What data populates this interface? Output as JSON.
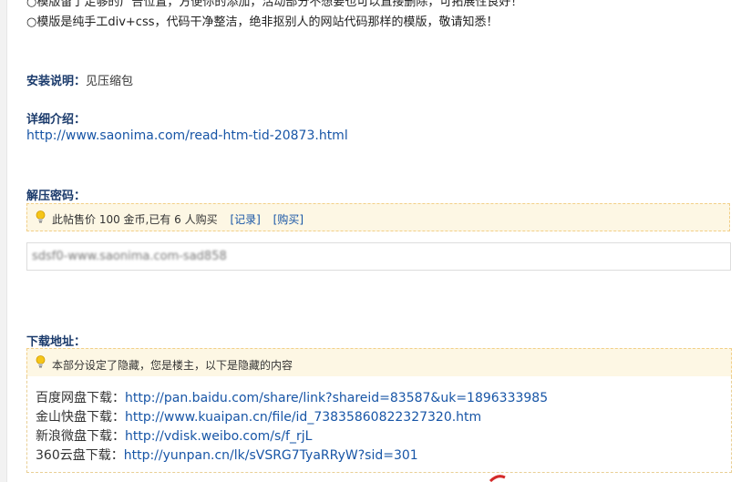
{
  "intro": {
    "line1": "○模版留了足够的广告位置，方便你的添加，活动部分不想要也可以直接删除，可拓展性良好！",
    "line2": "○模版是纯手工div+css，代码干净整洁，绝非抠别人的网站代码那样的模版，敬请知悉！"
  },
  "install": {
    "label": "安装说明：",
    "value": "见压缩包"
  },
  "details": {
    "label": "详细介绍：",
    "url": "http://www.saonima.com/read-htm-tid-20873.html"
  },
  "unzip": {
    "label": "解压密码：",
    "notice": {
      "text": "此帖售价 100 金币,已有 6 人购买",
      "record_link": "[记录]",
      "buy_link": "[购买]"
    },
    "password_blurred": "sdsf0-www.saonima.com-sad858"
  },
  "download": {
    "label": "下载地址：",
    "notice_text": "本部分设定了隐藏，您是楼主，以下是隐藏的内容",
    "links": [
      {
        "label": "百度网盘下载：",
        "url": "http://pan.baidu.com/share/link?shareid=83587&uk=1896333985"
      },
      {
        "label": "金山快盘下载：",
        "url": "http://www.kuaipan.cn/file/id_73835860822327320.htm"
      },
      {
        "label": "新浪微盘下载：",
        "url": "http://vdisk.weibo.com/s/f_rjL"
      },
      {
        "label": "360云盘下载：",
        "url": "http://yunpan.cn/lk/sVSRG7TyaRRyW?sid=301"
      }
    ]
  },
  "colors": {
    "heading": "#1a3a6b",
    "link": "#1755a6",
    "notice_bg": "#fdf7e4",
    "notice_border": "#f2cf88"
  }
}
